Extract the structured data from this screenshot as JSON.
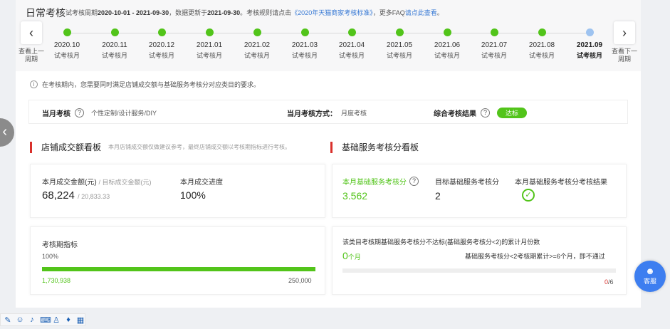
{
  "header": {
    "title": "日常考核",
    "period_prefix": "试考核周期",
    "period_range": "2020-10-01 - 2021-09-30",
    "update_prefix": "，数据更新于",
    "update_date": "2021-09-30",
    "rules_prefix": "。考核规则请点击",
    "rules_link": "《2020年天猫商家考核标准》",
    "faq_prefix": "，更多FAQ",
    "faq_link": "请点此查看",
    "faq_suffix": "。"
  },
  "timeline": {
    "prev_label": "查看上一周期",
    "next_label": "查看下一周期",
    "months": [
      {
        "name": "2020.10",
        "status": "试考核月"
      },
      {
        "name": "2020.11",
        "status": "试考核月"
      },
      {
        "name": "2020.12",
        "status": "试考核月"
      },
      {
        "name": "2021.01",
        "status": "试考核月"
      },
      {
        "name": "2021.02",
        "status": "试考核月"
      },
      {
        "name": "2021.03",
        "status": "试考核月"
      },
      {
        "name": "2021.04",
        "status": "试考核月"
      },
      {
        "name": "2021.05",
        "status": "试考核月"
      },
      {
        "name": "2021.06",
        "status": "试考核月"
      },
      {
        "name": "2021.07",
        "status": "试考核月"
      },
      {
        "name": "2021.08",
        "status": "试考核月"
      },
      {
        "name": "2021.09",
        "status": "试考核月"
      }
    ]
  },
  "notice": "在考核期内，您需要同时满足店铺成交额与基础服务考核分对应类目的要求。",
  "summary": {
    "assess_label": "当月考核",
    "assess_value": "个性定制/设计服务/DIY",
    "method_label": "当月考核方式：",
    "method_value": "月度考核",
    "result_label": "综合考核结果",
    "result_value": "达标"
  },
  "sales_board": {
    "title": "店铺成交额看板",
    "subtitle": "本月店铺成交额仅做建议参考，最终店铺成交额以考核期指标进行考核。",
    "amount_label": "本月成交金额(元)",
    "target_label": "/ 目标成交金额(元)",
    "amount_value": "68,224",
    "target_value": "/ 20,833.33",
    "progress_label": "本月成交进度",
    "progress_value": "100%",
    "period_label": "考核期指标",
    "period_percent": "100%",
    "period_fill": 1.0,
    "period_current": "1,730,938",
    "period_target": "250,000"
  },
  "service_board": {
    "title": "基础服务考核分看板",
    "score_label": "本月基础服务考核分",
    "score_value": "3.562",
    "target_label": "目标基础服务考核分",
    "target_value": "2",
    "result_label": "本月基础服务考核分考核结果",
    "fail_label": "该类目考核期基础服务考核分不达标(基础服务考核分<2)的累计月份数",
    "fail_count": "0",
    "fail_unit": "个月",
    "rule_text": "基础服务考核分<2考核期累计>=6个月，即不通过",
    "fail_fill": 0.0,
    "fraction_num": "0",
    "fraction_den": "/6"
  },
  "float": {
    "kefu_label": "客服"
  },
  "colors": {
    "green": "#52c41a",
    "accent_red": "#d9302b",
    "link_blue": "#3a7bd5",
    "kefu_blue": "#3d7ef0"
  }
}
